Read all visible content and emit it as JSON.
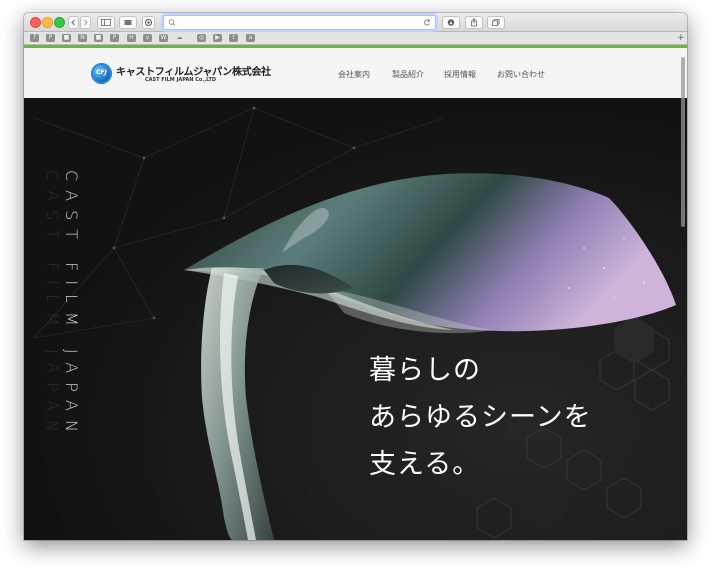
{
  "browser": {
    "url": "",
    "bookmark_icons": [
      "facebook-icon",
      "pinterest-icon",
      "bookmark-icon",
      "n-icon",
      "bookmark-icon",
      "p-icon",
      "h-icon",
      "vimeo-icon",
      "w-icon",
      "soundcloud-icon",
      "instagram-icon",
      "youtube-icon",
      "tumblr-icon",
      "amazon-icon"
    ],
    "add_tab_label": "+"
  },
  "site": {
    "logo_mark": "CFJ",
    "logo_name": "キャストフィルムジャパン株式会社",
    "logo_subtitle": "CAST FILM JAPAN Co.,LTD",
    "nav": [
      "会社案内",
      "製品紹介",
      "採用情報",
      "お問い合わせ"
    ]
  },
  "hero": {
    "vertical_text_1": "CAST FILM JAPAN",
    "vertical_text_2": "CAST FILM JAPAN",
    "headline": [
      "暮らしの",
      "あらゆるシーンを",
      "支える。"
    ]
  }
}
